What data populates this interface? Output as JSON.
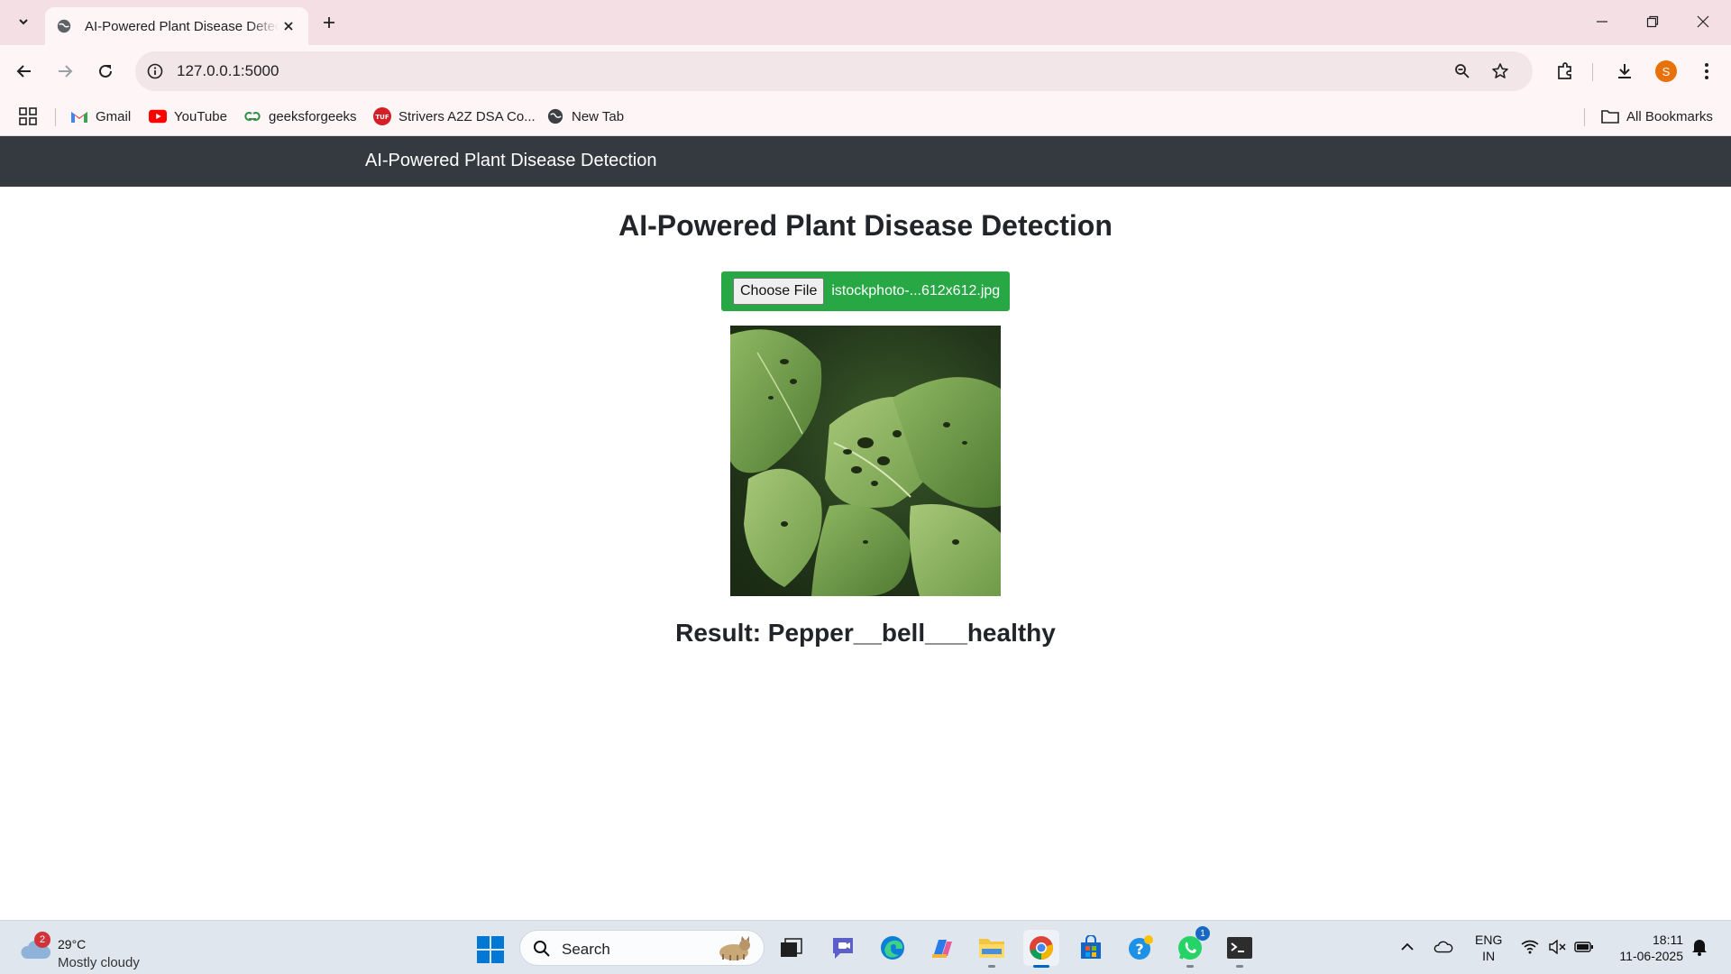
{
  "browser": {
    "tab_title": "AI-Powered Plant Disease Detection",
    "url": "127.0.0.1:5000",
    "profile_initial": "S",
    "bookmarks": [
      {
        "label": "Gmail",
        "icon": "gmail-icon"
      },
      {
        "label": "YouTube",
        "icon": "youtube-icon"
      },
      {
        "label": "geeksforgeeks",
        "icon": "gfg-icon"
      },
      {
        "label": "Strivers A2Z DSA Co...",
        "icon": "tuf-icon"
      },
      {
        "label": "New Tab",
        "icon": "globe-icon"
      }
    ],
    "all_bookmarks_label": "All Bookmarks"
  },
  "page": {
    "nav_brand": "AI-Powered Plant Disease Detection",
    "heading": "AI-Powered Plant Disease Detection",
    "choose_file_label": "Choose File",
    "file_name": "istockphoto-...612x612.jpg",
    "result": "Result: Pepper__bell___healthy",
    "colors": {
      "navbar": "#343a40",
      "upload_bg": "#28a745"
    }
  },
  "taskbar": {
    "weather_badge": "2",
    "temperature": "29°C",
    "condition": "Mostly cloudy",
    "search_label": "Search",
    "whatsapp_badge": "1",
    "lang_top": "ENG",
    "lang_bottom": "IN",
    "time": "18:11",
    "date": "11-06-2025"
  }
}
